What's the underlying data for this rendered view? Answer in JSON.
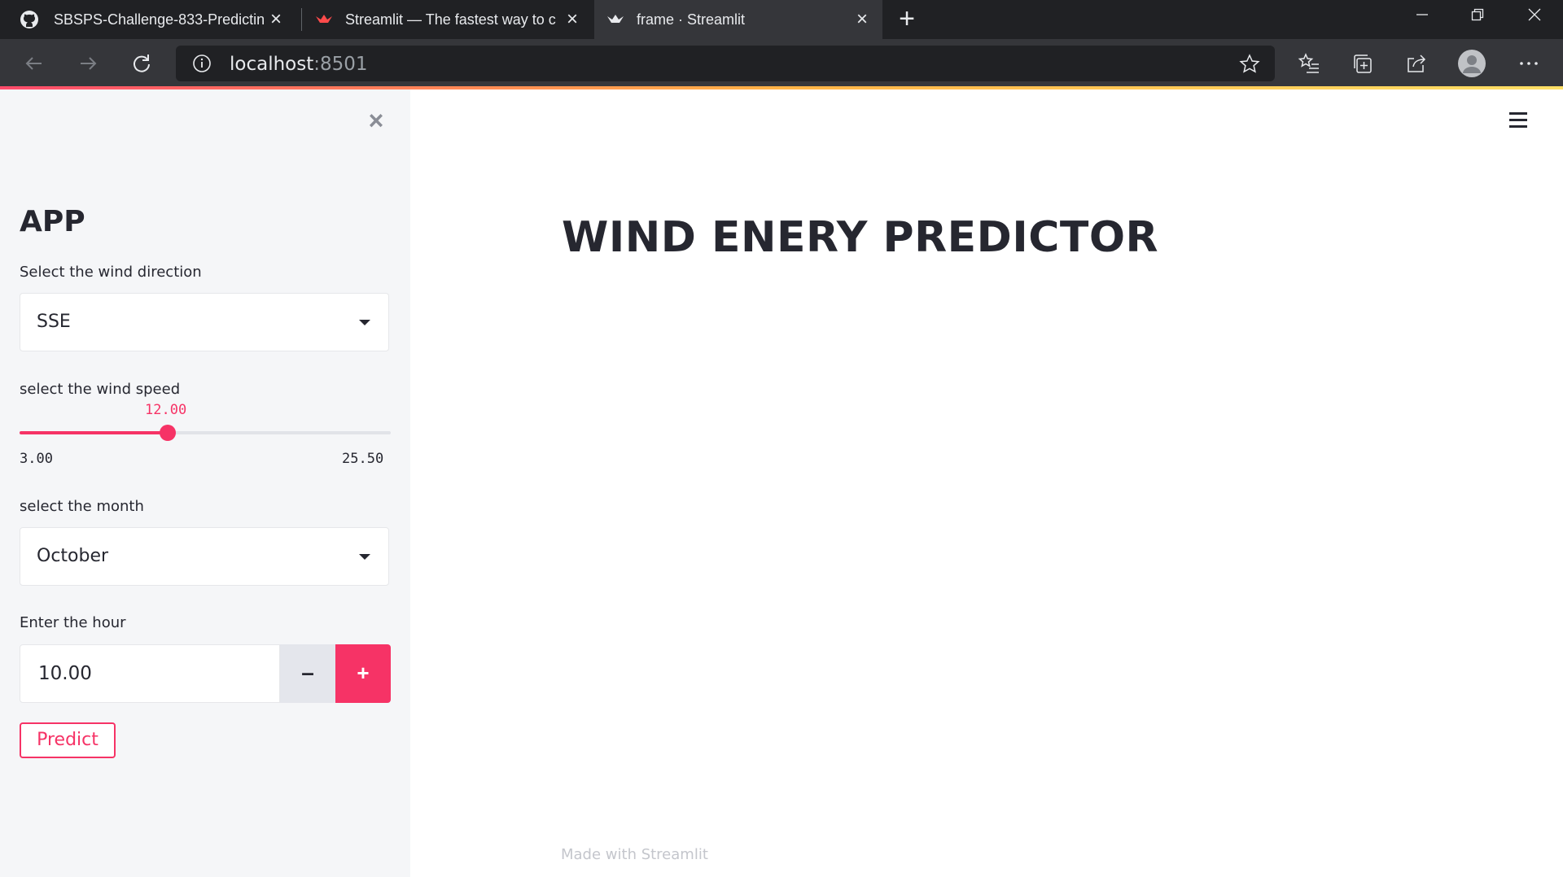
{
  "browser": {
    "tabs": [
      {
        "title": "SBSPS-Challenge-833-Predicting",
        "icon": "github-icon"
      },
      {
        "title": "Streamlit — The fastest way to c",
        "icon": "streamlit-icon"
      },
      {
        "title": "frame · Streamlit",
        "icon": "streamlit-icon",
        "active": true
      }
    ],
    "url_host": "localhost",
    "url_port": ":8501"
  },
  "sidebar": {
    "title": "APP",
    "wind_direction": {
      "label": "Select the wind direction",
      "value": "SSE"
    },
    "wind_speed": {
      "label": "select the wind speed",
      "value": "12.00",
      "min": "3.00",
      "max": "25.50",
      "fraction": 0.4
    },
    "month": {
      "label": "select the month",
      "value": "October"
    },
    "hour": {
      "label": "Enter the hour",
      "value": "10.00",
      "minus": "–",
      "plus": "+"
    },
    "predict_label": "Predict"
  },
  "main": {
    "title": "WIND ENERY PREDICTOR",
    "footer": "Made with Streamlit"
  },
  "colors": {
    "accent": "#f63366",
    "text": "#262730",
    "sidebar_bg": "#f5f6f8"
  }
}
